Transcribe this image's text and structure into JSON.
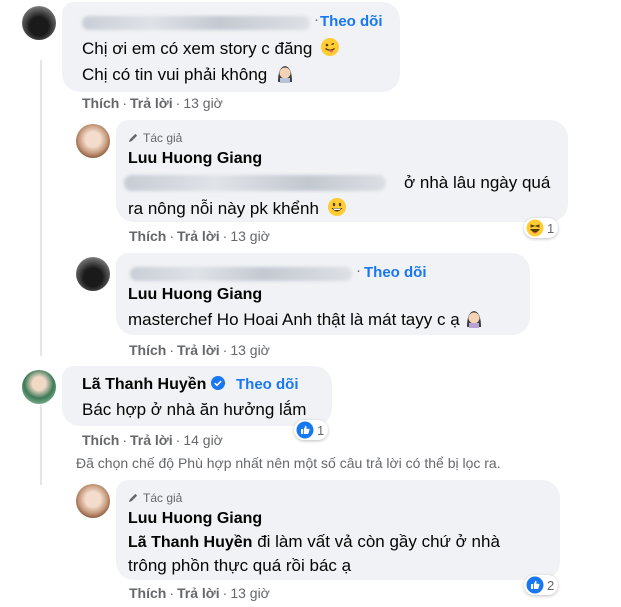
{
  "comments": [
    {
      "id": "c1",
      "name": "Nguyễn Hoàng Phương Dung",
      "follow_label": "Theo dõi",
      "lines": [
        "Chị ơi em có xem story c đăng",
        "Chị có tin vui phải không"
      ],
      "emoji": [
        "face-with-tongue-emoji",
        "woman-tipping-hand-emoji"
      ],
      "actions": {
        "like": "Thích",
        "reply": "Trả lời",
        "time": "13 giờ"
      }
    },
    {
      "id": "c2",
      "author_badge": "Tác giả",
      "name": "Luu Huong Giang",
      "mention": "Nguyễn Hoàng Phương Dung",
      "lines": [
        "ở nhà lâu ngày quá",
        "ra nông nỗi này pk khểnh"
      ],
      "emoji": [
        "grinning-face-emoji"
      ],
      "actions": {
        "like": "Thích",
        "reply": "Trả lời",
        "time": "13 giờ"
      },
      "reaction": {
        "type": "haha",
        "count": "1"
      }
    },
    {
      "id": "c3",
      "name": "Nguyễn Hoàng Phương Dung",
      "follow_label": "Theo dõi",
      "mention": "Luu Huong Giang",
      "lines": [
        "masterchef Ho Hoai Anh thật là mát tayy c ạ"
      ],
      "emoji": [
        "woman-tipping-hand-emoji"
      ],
      "actions": {
        "like": "Thích",
        "reply": "Trả lời",
        "time": "13 giờ"
      }
    },
    {
      "id": "c4",
      "name": "Lã Thanh Huyền",
      "verified": true,
      "follow_label": "Theo dõi",
      "lines": [
        "Bác hợp ở nhà ăn hưởng lắm"
      ],
      "actions": {
        "like": "Thích",
        "reply": "Trả lời",
        "time": "14 giờ"
      },
      "reaction": {
        "type": "like",
        "count": "1"
      }
    },
    {
      "id": "c5",
      "author_badge": "Tác giả",
      "name": "Luu Huong Giang",
      "mention": "Lã Thanh Huyền",
      "lines": [
        "đi làm vất vả còn gầy chứ ở nhà",
        "trông phồn thực quá rồi bác ạ"
      ],
      "actions": {
        "like": "Thích",
        "reply": "Trả lời",
        "time": "13 giờ"
      },
      "reaction": {
        "type": "like",
        "count": "2"
      }
    }
  ],
  "filter_notice": "Đã chọn chế độ Phù hợp nhất nên một số câu trả lời có thể bị lọc ra.",
  "colors": {
    "link": "#1877f2",
    "bubble": "#f0f2f5",
    "meta": "#65676b",
    "text": "#050505"
  }
}
